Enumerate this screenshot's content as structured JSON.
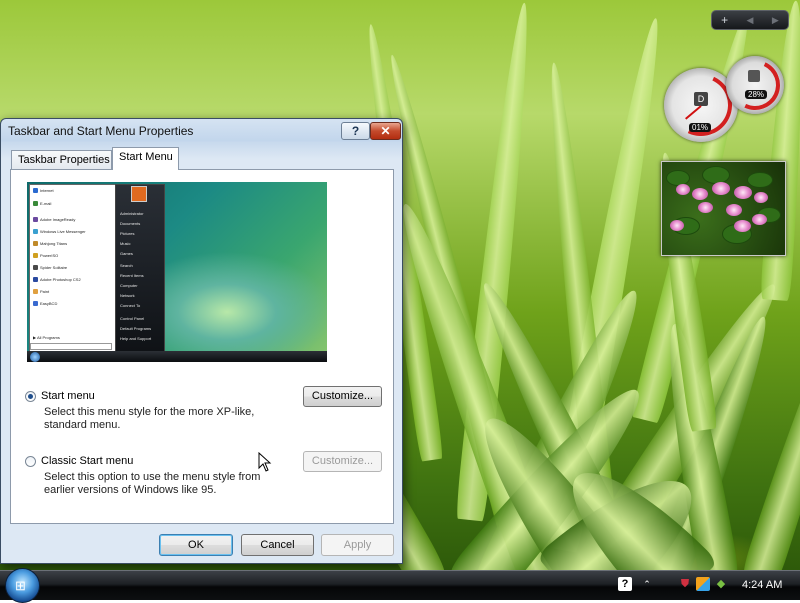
{
  "dialog": {
    "title": "Taskbar and Start Menu Properties",
    "help_label": "?",
    "close_label": "✕",
    "tabs": [
      {
        "label": "Taskbar Properties",
        "active": false
      },
      {
        "label": "Start Menu",
        "active": true
      }
    ],
    "preview": {
      "left_items": [
        "Internet",
        "E-mail",
        "Adobe ImageReady",
        "Windows Live Messenger",
        "Mahjong Titans",
        "PowerISO",
        "Spider Solitaire",
        "Adobe Photoshop CS2",
        "Paint",
        "EasyBCD"
      ],
      "all_programs": "All Programs",
      "right_items": [
        "Administrator",
        "Documents",
        "Pictures",
        "Music",
        "Games",
        "Search",
        "Recent Items",
        "Computer",
        "Network",
        "Connect To",
        "Control Panel",
        "Default Programs",
        "Help and Support"
      ]
    },
    "options": [
      {
        "label": "Start menu",
        "description": "Select this menu style for the more XP-like, standard menu.",
        "selected": true,
        "customize_label": "Customize...",
        "customize_enabled": true
      },
      {
        "label": "Classic Start menu",
        "description": "Select this option to use the menu style from earlier versions of Windows like 95.",
        "selected": false,
        "customize_label": "Customize...",
        "customize_enabled": false
      }
    ],
    "buttons": {
      "ok": "OK",
      "cancel": "Cancel",
      "apply": "Apply"
    }
  },
  "sidebar": {
    "add_label": "+",
    "prev_label": "◀",
    "next_label": "▶",
    "cpu_gauge": {
      "readout": "01%",
      "value_percent": 1
    },
    "memory_gauge": {
      "readout": "28%",
      "value_percent": 28
    }
  },
  "taskbar": {
    "clock": "4:24 AM",
    "tray_icons": [
      "help-icon",
      "network-icon",
      "security-icon",
      "windows-update-icon"
    ]
  },
  "colors": {
    "accent": "#1f4e8c",
    "close": "#c44a2c",
    "taskbar": "#0d0f11"
  }
}
